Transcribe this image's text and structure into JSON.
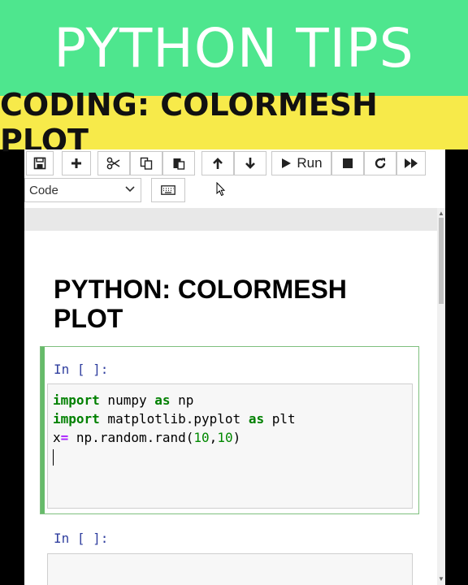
{
  "banner": {
    "title": "PYTHON TIPS",
    "subtitle": "CODING: COLORMESH PLOT"
  },
  "toolbar": {
    "save_icon": "floppy-disk-icon",
    "add_icon": "plus-icon",
    "cut_icon": "scissors-icon",
    "copy_icon": "copy-icon",
    "paste_icon": "paste-icon",
    "move_up_icon": "arrow-up-icon",
    "move_down_icon": "arrow-down-icon",
    "run_label": "Run",
    "stop_icon": "stop-icon",
    "restart_icon": "restart-icon",
    "fast_forward_icon": "fast-forward-icon",
    "cell_type_value": "Code",
    "keyboard_icon": "keyboard-icon"
  },
  "notebook": {
    "heading": "PYTHON: COLORMESH PLOT",
    "cells": [
      {
        "prompt": "In [ ]:",
        "code_lines": [
          [
            {
              "t": "import",
              "c": "kw"
            },
            {
              "t": " numpy ",
              "c": ""
            },
            {
              "t": "as",
              "c": "kw"
            },
            {
              "t": " np",
              "c": ""
            }
          ],
          [
            {
              "t": "import",
              "c": "kw"
            },
            {
              "t": " matplotlib.pyplot ",
              "c": ""
            },
            {
              "t": "as",
              "c": "kw"
            },
            {
              "t": " plt",
              "c": ""
            }
          ],
          [
            {
              "t": "x",
              "c": ""
            },
            {
              "t": "=",
              "c": "op"
            },
            {
              "t": " np.random.rand(",
              "c": ""
            },
            {
              "t": "10",
              "c": "num"
            },
            {
              "t": ",",
              "c": ""
            },
            {
              "t": "10",
              "c": "num"
            },
            {
              "t": ")",
              "c": ""
            }
          ]
        ]
      },
      {
        "prompt": "In [ ]:",
        "code_lines": []
      }
    ]
  },
  "colors": {
    "banner_green": "#4ee68e",
    "banner_yellow": "#f7ea4a",
    "keyword": "#008000",
    "prompt": "#303f9f"
  }
}
